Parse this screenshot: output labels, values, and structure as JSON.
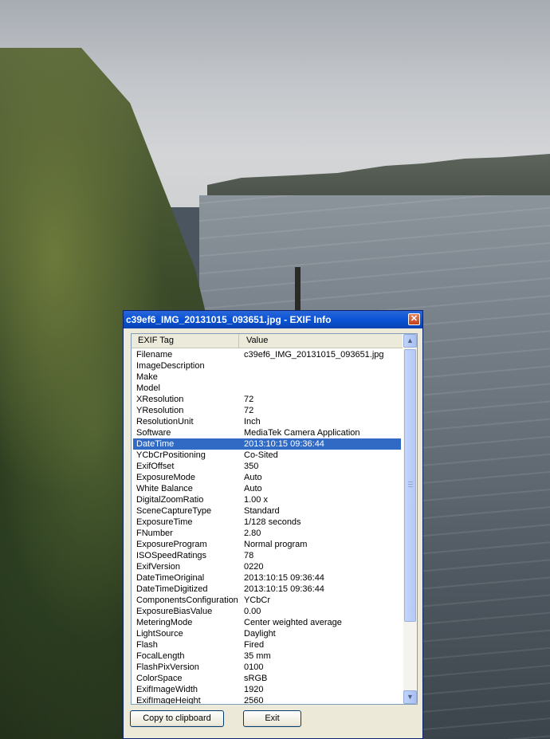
{
  "window": {
    "title": "c39ef6_IMG_20131015_093651.jpg - EXIF Info",
    "close_glyph": "✕"
  },
  "list": {
    "columns": [
      "EXIF Tag",
      "Value"
    ],
    "selected_index": 8,
    "rows": [
      {
        "tag": "Filename",
        "value": "c39ef6_IMG_20131015_093651.jpg"
      },
      {
        "tag": "ImageDescription",
        "value": ""
      },
      {
        "tag": "Make",
        "value": ""
      },
      {
        "tag": "Model",
        "value": ""
      },
      {
        "tag": "XResolution",
        "value": "72"
      },
      {
        "tag": "YResolution",
        "value": "72"
      },
      {
        "tag": "ResolutionUnit",
        "value": "Inch"
      },
      {
        "tag": "Software",
        "value": "MediaTek Camera Application"
      },
      {
        "tag": "DateTime",
        "value": "2013:10:15 09:36:44"
      },
      {
        "tag": "YCbCrPositioning",
        "value": "Co-Sited"
      },
      {
        "tag": "ExifOffset",
        "value": "350"
      },
      {
        "tag": "ExposureMode",
        "value": "Auto"
      },
      {
        "tag": "White Balance",
        "value": "Auto"
      },
      {
        "tag": "DigitalZoomRatio",
        "value": "1.00 x"
      },
      {
        "tag": "SceneCaptureType",
        "value": "Standard"
      },
      {
        "tag": "ExposureTime",
        "value": "1/128 seconds"
      },
      {
        "tag": "FNumber",
        "value": "2.80"
      },
      {
        "tag": "ExposureProgram",
        "value": "Normal program"
      },
      {
        "tag": "ISOSpeedRatings",
        "value": "78"
      },
      {
        "tag": "ExifVersion",
        "value": "0220"
      },
      {
        "tag": "DateTimeOriginal",
        "value": "2013:10:15 09:36:44"
      },
      {
        "tag": "DateTimeDigitized",
        "value": "2013:10:15 09:36:44"
      },
      {
        "tag": "ComponentsConfiguration",
        "value": "YCbCr"
      },
      {
        "tag": "ExposureBiasValue",
        "value": "0.00"
      },
      {
        "tag": "MeteringMode",
        "value": "Center weighted average"
      },
      {
        "tag": "LightSource",
        "value": "Daylight"
      },
      {
        "tag": "Flash",
        "value": "Fired"
      },
      {
        "tag": "FocalLength",
        "value": "35 mm"
      },
      {
        "tag": "FlashPixVersion",
        "value": "0100"
      },
      {
        "tag": "ColorSpace",
        "value": "sRGB"
      },
      {
        "tag": "ExifImageWidth",
        "value": "1920"
      },
      {
        "tag": "ExifImageHeight",
        "value": "2560"
      }
    ]
  },
  "scrollbar": {
    "up_glyph": "▲",
    "down_glyph": "▼"
  },
  "buttons": {
    "copy": "Copy to clipboard",
    "exit": "Exit"
  },
  "colors": {
    "selection": "#316ac5",
    "titlebar": "#0a53d6"
  }
}
